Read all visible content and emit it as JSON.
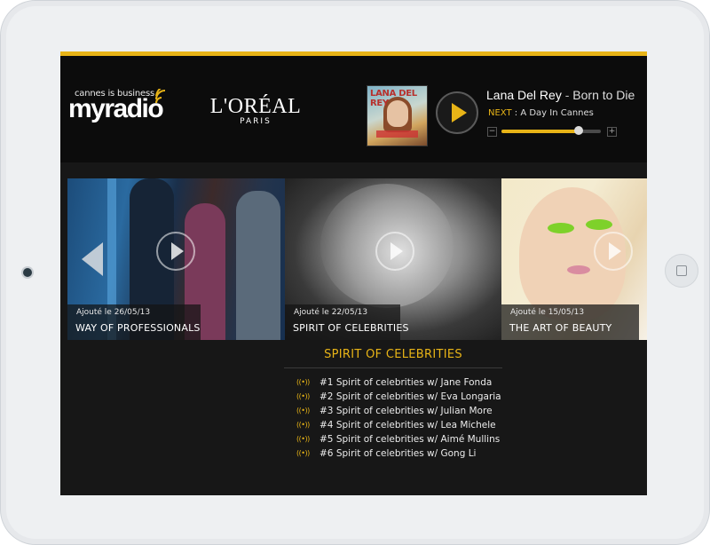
{
  "header": {
    "myradio_tagline": "cannes is business",
    "myradio_name": "myradio",
    "loreal_name": "L'ORÉAL",
    "loreal_sub": "PARIS"
  },
  "album": {
    "cover_text": "LANA DEL REY"
  },
  "now_playing": {
    "artist": "Lana Del Rey",
    "separator": " - ",
    "song": "Born to Die",
    "next_label": "NEXT",
    "next_separator": " : ",
    "next_title": "A Day In Cannes",
    "volume_minus": "−",
    "volume_plus": "+",
    "volume_level": 0.78
  },
  "cards": [
    {
      "date": "Ajouté le 26/05/13",
      "title": "WAY OF PROFESSIONALS"
    },
    {
      "date": "Ajouté le 22/05/13",
      "title": "SPIRIT OF CELEBRITIES"
    },
    {
      "date": "Ajouté le 15/05/13",
      "title": "THE ART OF BEAUTY"
    }
  ],
  "playlist": {
    "title": "SPIRIT OF CELEBRITIES",
    "items": [
      "#1 Spirit of celebrities  w/ Jane Fonda",
      "#2 Spirit of celebrities  w/ Eva Longaria",
      "#3 Spirit of celebrities  w/ Julian More",
      "#4 Spirit of celebrities w/ Lea Michele",
      "#5 Spirit of celebrities w/ Aimé Mullins",
      "#6 Spirit of celebrities w/ Gong Li"
    ]
  },
  "colors": {
    "accent": "#e8b417",
    "background": "#171717",
    "header": "#0c0c0c"
  }
}
